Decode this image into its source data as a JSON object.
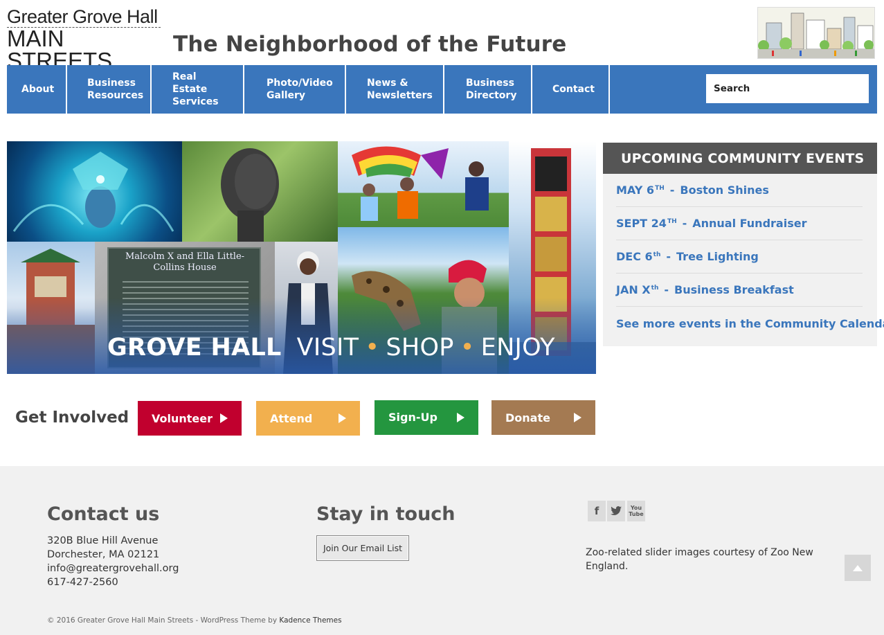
{
  "header": {
    "logo_line1": "Greater Grove Hall",
    "logo_line2": "MAIN STREETS",
    "logo_colors": [
      "#c1002e",
      "#f2b04e",
      "#24963f",
      "#a47a52",
      "#3a76bc",
      "#222222",
      "#c8453a"
    ],
    "tagline": "The Neighborhood of the Future"
  },
  "nav": {
    "items": [
      {
        "label": "About"
      },
      {
        "label": "Business Resources"
      },
      {
        "label": "Real Estate Services"
      },
      {
        "label": "Photo/Video Gallery"
      },
      {
        "label": "News & Newsletters"
      },
      {
        "label": "Business Directory"
      },
      {
        "label": "Contact"
      }
    ],
    "search_placeholder": "Search",
    "color": "#3a76bc"
  },
  "hero": {
    "caption_strong": "GROVE HALL",
    "caption_words": [
      "VISIT",
      "SHOP",
      "ENJOY"
    ],
    "plaque_title": "Malcolm X and Ella Little-Collins House"
  },
  "events": {
    "heading": "UPCOMING COMMUNITY EVENTS",
    "items": [
      {
        "date": "MAY 6",
        "sup": "TH",
        "name": "Boston Shines"
      },
      {
        "date": "SEPT 24",
        "sup": "TH",
        "name": "Annual Fundraiser"
      },
      {
        "date": "DEC 6",
        "sup": "th",
        "name": "Tree Lighting"
      },
      {
        "date": "JAN X",
        "sup": "th",
        "name": "Business Breakfast"
      }
    ],
    "separator": "-",
    "more_link": "See more events in the Community Calendar"
  },
  "get_involved": {
    "label": "Get Involved",
    "buttons": [
      {
        "label": "Volunteer",
        "color": "#c1002e"
      },
      {
        "label": "Attend",
        "color": "#f2b04e"
      },
      {
        "label": "Sign-Up",
        "color": "#24963f"
      },
      {
        "label": "Donate",
        "color": "#a47a52"
      }
    ]
  },
  "footer": {
    "contact_title": "Contact us",
    "address1": "320B Blue Hill Avenue",
    "address2": "Dorchester, MA 02121",
    "email": "info@greatergrovehall.org",
    "phone": "617-427-2560",
    "stay_title": "Stay in touch",
    "email_button": "Join Our Email List",
    "social": [
      {
        "icon": "facebook-icon",
        "glyph": "f"
      },
      {
        "icon": "twitter-icon",
        "glyph": "t"
      },
      {
        "icon": "youtube-icon",
        "glyph": "You Tube"
      }
    ],
    "credit": "Zoo-related slider images courtesy of Zoo New England.",
    "copyright": "© 2016 Greater Grove Hall Main Streets - WordPress Theme by",
    "theme_link": "Kadence Themes"
  }
}
